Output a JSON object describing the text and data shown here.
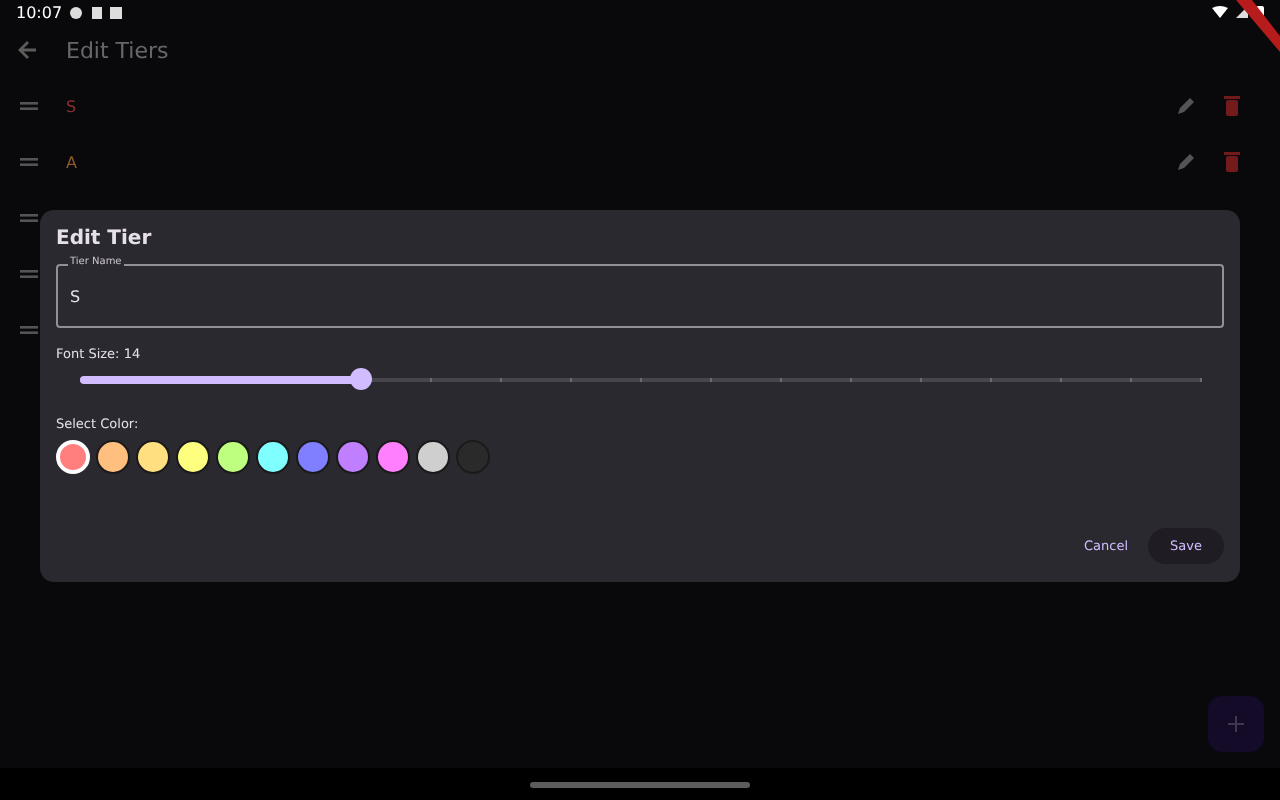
{
  "status_bar": {
    "time": "10:07"
  },
  "app_bar": {
    "title": "Edit Tiers"
  },
  "tiers": [
    {
      "kind": "tier",
      "name": "S",
      "color": "#8a3030"
    },
    {
      "kind": "tier",
      "name": "A",
      "color": "#8a5a2e"
    },
    {
      "kind": "covered"
    },
    {
      "kind": "covered"
    },
    {
      "kind": "covered"
    }
  ],
  "dialog": {
    "title": "Edit Tier",
    "name_field": {
      "label": "Tier Name",
      "value": "S"
    },
    "font_size_label": "Font Size: 14",
    "font_size": {
      "level": 0.25
    },
    "color_label": "Select Color:",
    "colors": [
      {
        "color": "#ff7f7f",
        "selected": true
      },
      {
        "color": "#ffbf7f",
        "selected": false
      },
      {
        "color": "#ffdf7f",
        "selected": false
      },
      {
        "color": "#ffff7f",
        "selected": false
      },
      {
        "color": "#bfff7f",
        "selected": false
      },
      {
        "color": "#7fffff",
        "selected": false
      },
      {
        "color": "#7f7fff",
        "selected": false
      },
      {
        "color": "#bf7fff",
        "selected": false
      },
      {
        "color": "#ff7fff",
        "selected": false
      },
      {
        "color": "#cfcfcf",
        "selected": false
      },
      {
        "color": "#2a2a2a",
        "selected": false
      }
    ],
    "buttons": [
      {
        "kind": "text",
        "label": "Cancel"
      },
      {
        "kind": "tonal",
        "label": "Save"
      }
    ]
  }
}
